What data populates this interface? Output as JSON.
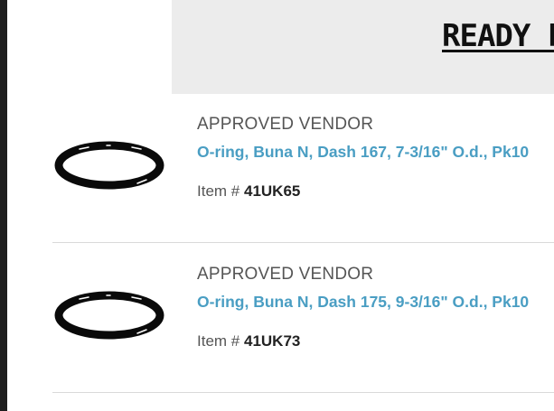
{
  "banner": {
    "title": "READY F"
  },
  "products": [
    {
      "vendor": "APPROVED VENDOR",
      "title": "O-ring, Buna N, Dash 167, 7-3/16\" O.d., Pk10",
      "item_prefix": "Item #",
      "item_number": "41UK65",
      "image_icon": "o-ring-icon"
    },
    {
      "vendor": "APPROVED VENDOR",
      "title": "O-ring, Buna N, Dash 175, 9-3/16\" O.d., Pk10",
      "item_prefix": "Item #",
      "item_number": "41UK73",
      "image_icon": "o-ring-icon"
    }
  ],
  "colors": {
    "link": "#4a9ec3",
    "banner_bg": "#ececec",
    "left_border": "#1e1e1e"
  }
}
